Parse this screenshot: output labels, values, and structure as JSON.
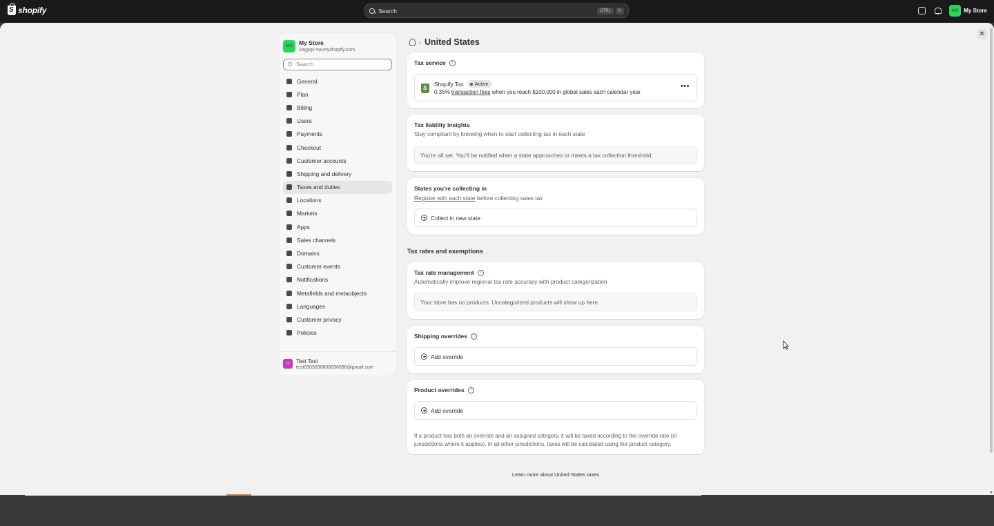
{
  "topbar": {
    "brand": "shopify",
    "search_placeholder": "Search",
    "shortcut_key1": "CTRL",
    "shortcut_key2": "K",
    "store_initials": "MS",
    "store_name": "My Store"
  },
  "sidebar": {
    "store_initials": "MS",
    "store_name": "My Store",
    "store_url": "1egyqc-vw.myshopify.com",
    "search_placeholder": "Search",
    "items": [
      {
        "label": "General"
      },
      {
        "label": "Plan"
      },
      {
        "label": "Billing"
      },
      {
        "label": "Users"
      },
      {
        "label": "Payments"
      },
      {
        "label": "Checkout"
      },
      {
        "label": "Customer accounts"
      },
      {
        "label": "Shipping and delivery"
      },
      {
        "label": "Taxes and duties"
      },
      {
        "label": "Locations"
      },
      {
        "label": "Markets"
      },
      {
        "label": "Apps"
      },
      {
        "label": "Sales channels"
      },
      {
        "label": "Domains"
      },
      {
        "label": "Customer events"
      },
      {
        "label": "Notifications"
      },
      {
        "label": "Metafields and metaobjects"
      },
      {
        "label": "Languages"
      },
      {
        "label": "Customer privacy"
      },
      {
        "label": "Policies"
      }
    ],
    "active_item": "Taxes and duties",
    "user_initials": "TT",
    "user_name": "Test Test",
    "user_email": "test0909090808096098@gmail.com"
  },
  "page": {
    "breadcrumb_title": "United States",
    "tax_service": {
      "title": "Tax service",
      "provider": "Shopify Tax",
      "status": "Active",
      "desc_prefix": "0.35%",
      "desc_link": "transaction fees",
      "desc_suffix": "when you reach $100,000 in global sales each calendar year"
    },
    "liability": {
      "title": "Tax liability insights",
      "subtitle": "Stay compliant by knowing when to start collecting tax in each state",
      "message": "You're all set. You'll be notified when a state approaches or meets a tax collection threshold."
    },
    "states": {
      "title": "States you're collecting in",
      "link": "Register with each state",
      "suffix": "before collecting sales tax",
      "button": "Collect in new state"
    },
    "rates_heading": "Tax rates and exemptions",
    "rate_mgmt": {
      "title": "Tax rate management",
      "subtitle": "Automatically improve regional tax rate accuracy with product categorization",
      "message": "Your store has no products. Uncategorized products will show up here."
    },
    "shipping_overrides": {
      "title": "Shipping overrides",
      "button": "Add override"
    },
    "product_overrides": {
      "title": "Product overrides",
      "button": "Add override",
      "note": "If a product has both an override and an assigned category, it will be taxed according to the override rate (in jurisdictions where it applies). In all other jurisdictions, taxes will be calculated using the product category."
    },
    "learn_more": "Learn more about United States taxes"
  },
  "colors": {
    "topbar_bg": "#1a1a1a",
    "page_bg": "#f1f1f1",
    "store_avatar": "#2fd35c",
    "user_avatar": "#c73ab8",
    "status_dot": "#2c6e49"
  }
}
